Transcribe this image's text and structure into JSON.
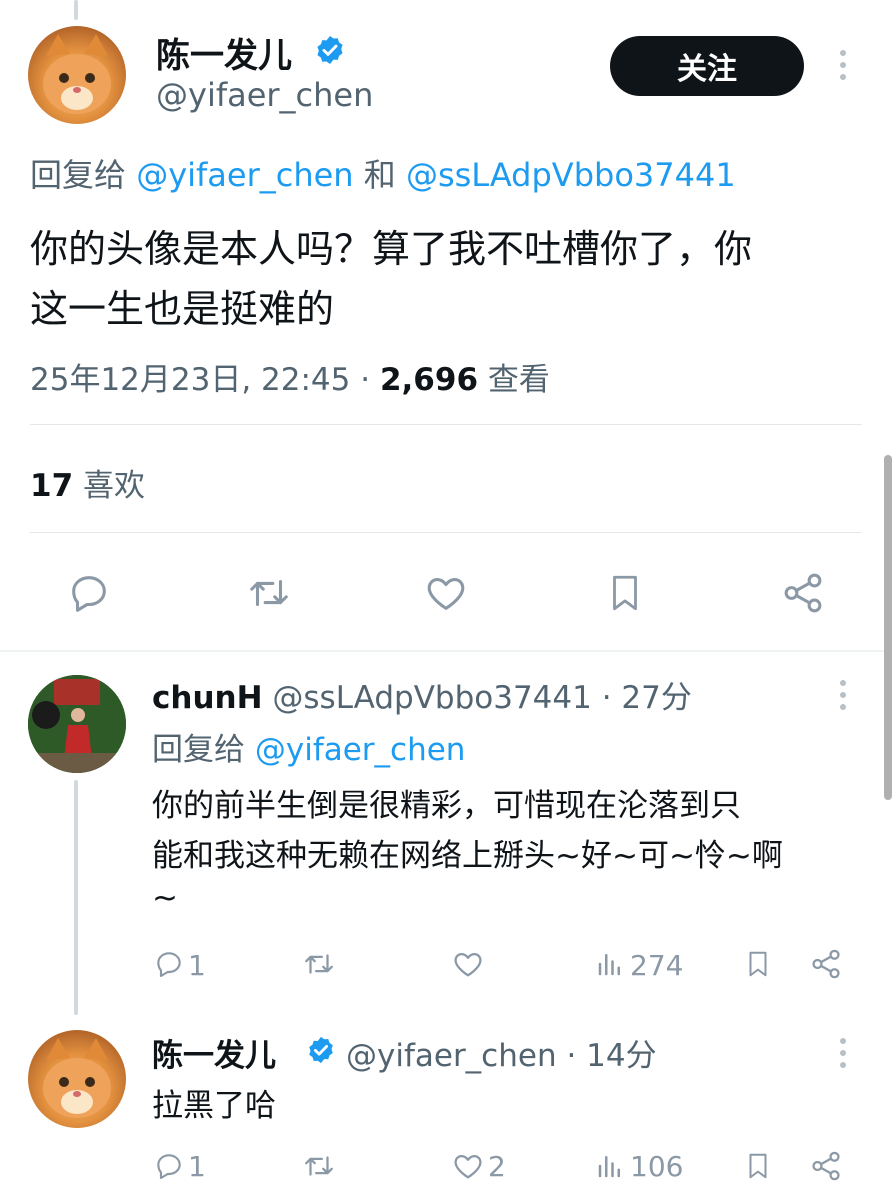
{
  "main_tweet": {
    "display_name": "陈一发儿",
    "handle": "@yifaer_chen",
    "follow_label": "关注",
    "reply_prefix": "回复给",
    "reply_user1": "@yifaer_chen",
    "reply_and": "和",
    "reply_user2": "@ssLAdpVbbo37441",
    "text_line1": "你的头像是本人吗？算了我不吐槽你了，你",
    "text_line2": "这一生也是挺难的",
    "timestamp": "25年12月23日, 22:45 ·",
    "views_count": "2,696",
    "views_label": "查看",
    "likes_count": "17",
    "likes_label": "喜欢"
  },
  "reply1": {
    "display_name": "chunH",
    "handle_time": "@ssLAdpVbbo37441 · 27分",
    "reply_prefix": "回复给",
    "reply_user": "@yifaer_chen",
    "text_line1": "你的前半生倒是很精彩，可惜现在沦落到只",
    "text_line2": "能和我这种无赖在网络上掰头~好~可~怜~啊",
    "text_line3": "~",
    "reply_count": "1",
    "views_count": "274"
  },
  "reply2": {
    "display_name": "陈一发儿",
    "handle_time": "@yifaer_chen · 14分",
    "text": "拉黑了哈",
    "reply_count": "1",
    "like_count": "2",
    "views_count": "106"
  },
  "icons": [
    "verified-badge-icon",
    "more-icon",
    "reply-icon",
    "retweet-icon",
    "like-icon",
    "bookmark-icon",
    "share-icon",
    "views-icon"
  ],
  "colors": {
    "link": "#1d9bf0",
    "secondary": "#536471",
    "icon": "#8b98a5",
    "button_bg": "#0f1419"
  }
}
